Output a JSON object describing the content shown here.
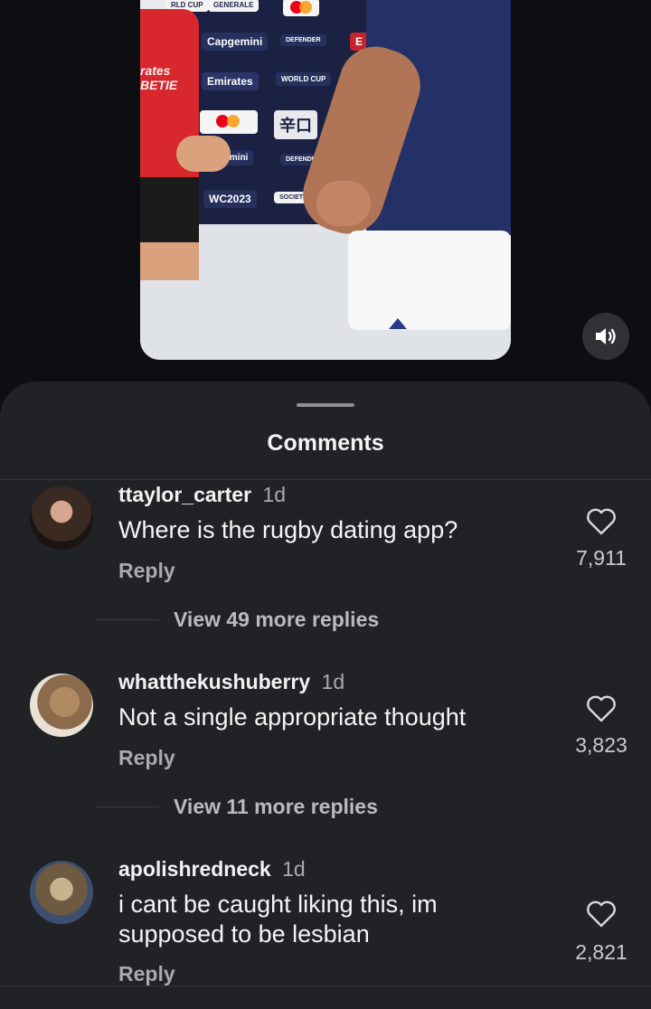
{
  "video": {
    "sponsors": {
      "top_left": "RLD CUP",
      "top_center": "GENERALE",
      "capgemini": "Capgemini",
      "defender": "DEFENDER",
      "emirates": "Emirates",
      "worldcup": "WORLD CUP",
      "kanji": "辛口",
      "capgemini2": "pgemini",
      "defender2": "DEFENDER",
      "rwc": "WC2023",
      "societe": "SOCIETE GENERA",
      "edge_e": "E",
      "left_emirates": "rates",
      "left_betie": "BETIE"
    },
    "volume_icon": "speaker-on-icon"
  },
  "comments_sheet": {
    "title": "Comments",
    "comments": [
      {
        "username": "ttaylor_carter",
        "time": "1d",
        "text": "Where is the rugby dating app?",
        "reply_label": "Reply",
        "likes": "7,911",
        "view_replies": "View 49 more replies"
      },
      {
        "username": "whatthekushuberry",
        "time": "1d",
        "text": "Not a single appropriate thought",
        "reply_label": "Reply",
        "likes": "3,823",
        "view_replies": "View 11 more replies"
      },
      {
        "username": "apolishredneck",
        "time": "1d",
        "text": "i cant be caught liking this, im supposed to be lesbian",
        "reply_label": "Reply",
        "likes": "2,821"
      }
    ]
  },
  "colors": {
    "background": "#0e0f12",
    "sheet": "#212226",
    "secondary_text": "#a8aab0"
  }
}
